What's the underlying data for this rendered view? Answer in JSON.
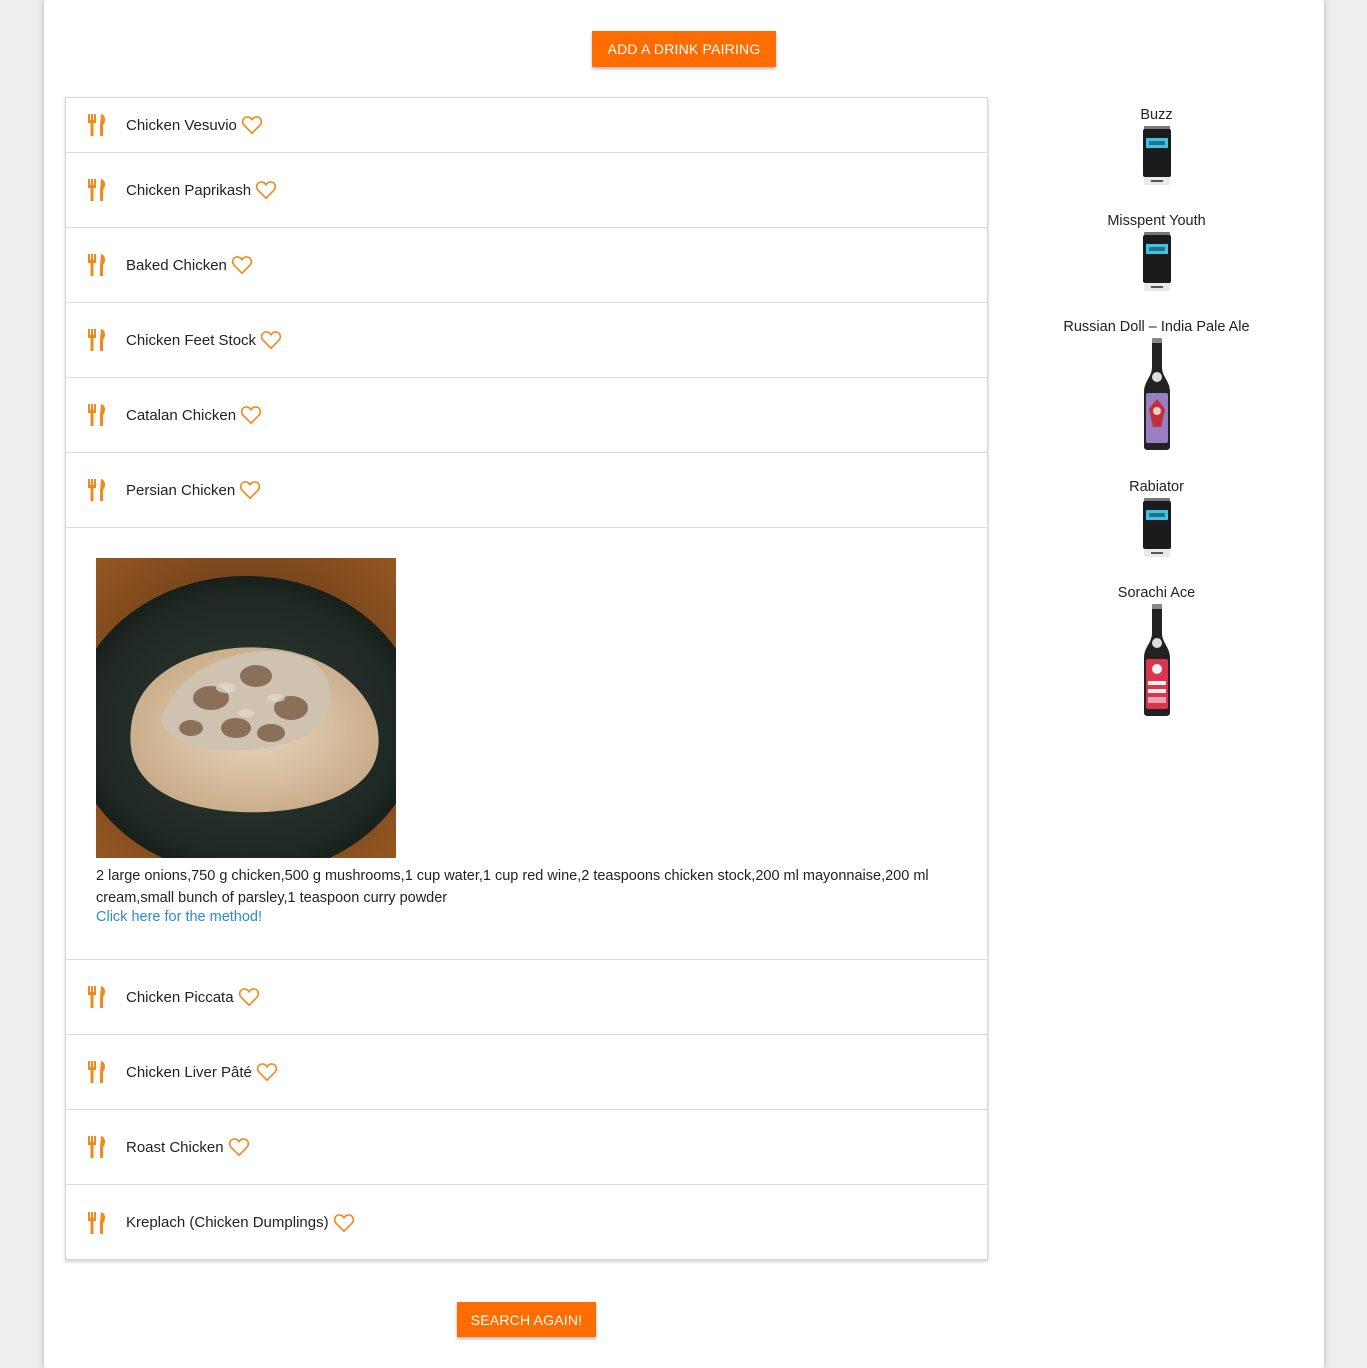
{
  "actions": {
    "add_drink_label": "ADD A DRINK PAIRING",
    "search_again_label": "SEARCH AGAIN!"
  },
  "recipes": [
    {
      "title": "Chicken Vesuvio"
    },
    {
      "title": "Chicken Paprikash"
    },
    {
      "title": "Baked Chicken"
    },
    {
      "title": "Chicken Feet Stock"
    },
    {
      "title": "Catalan Chicken"
    },
    {
      "title": "Persian Chicken"
    },
    {
      "title": "Chicken Piccata"
    },
    {
      "title": "Chicken Liver Pâté"
    },
    {
      "title": "Roast Chicken"
    },
    {
      "title": "Kreplach (Chicken Dumplings)"
    }
  ],
  "expanded": {
    "ingredients": "2 large onions,750 g chicken,500 g mushrooms,1 cup water,1 cup red wine,2 teaspoons chicken stock,200 ml mayonnaise,200 ml cream,small bunch of parsley,1 teaspoon curry powder",
    "method_link": "Click here for the method!"
  },
  "drinks": [
    {
      "name": "Buzz",
      "style": "can-blue"
    },
    {
      "name": "Misspent Youth",
      "style": "can-blue"
    },
    {
      "name": "Russian Doll – India Pale Ale",
      "style": "bottle-purple"
    },
    {
      "name": "Rabiator",
      "style": "can-blue"
    },
    {
      "name": "Sorachi Ace",
      "style": "bottle-red"
    }
  ],
  "colors": {
    "accent": "#ff6d00",
    "icon": "#f08a1c",
    "link": "#2a8cd3"
  },
  "icons": {
    "recipe": "fork-knife-icon",
    "favorite": "heart-outline-icon"
  }
}
